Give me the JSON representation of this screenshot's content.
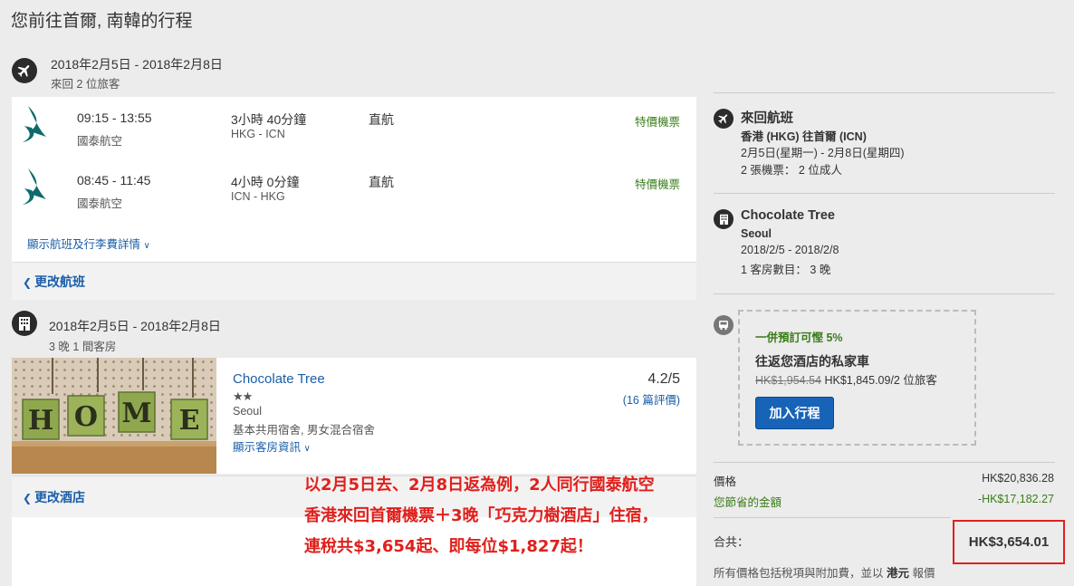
{
  "page": {
    "title": "您前往首爾, 南韓的行程"
  },
  "flight_section": {
    "date_range": "2018年2月5日 - 2018年2月8日",
    "sub": "來回 2 位旅客",
    "flights": [
      {
        "times": "09:15 - 13:55",
        "airline": "國泰航空",
        "duration": "3小時 40分鐘",
        "route": "HKG - ICN",
        "stops": "直航",
        "deal": "特價機票"
      },
      {
        "times": "08:45 - 11:45",
        "airline": "國泰航空",
        "duration": "4小時 0分鐘",
        "route": "ICN - HKG",
        "stops": "直航",
        "deal": "特價機票"
      }
    ],
    "details_link": "顯示航班及行李費詳情",
    "change_link": "更改航班"
  },
  "hotel_section": {
    "date_range": "2018年2月5日 - 2018年2月8日",
    "sub": "3 晚 1 間客房",
    "image_letters": [
      "H",
      "O",
      "M",
      "E"
    ],
    "name": "Chocolate Tree",
    "stars": "★★",
    "city": "Seoul",
    "type": "基本共用宿舍, 男女混合宿舍",
    "rooms_link": "顯示客房資訊",
    "rating": "4.2/5",
    "reviews": "(16 篇評價)",
    "change_link": "更改酒店"
  },
  "promo_overlay": {
    "lines": [
      "以2月5日去、2月8日返為例，2人同行國泰航空",
      "香港來回首爾機票＋3晚「巧克力樹酒店」住宿，",
      "連稅共$3,654起、即每位$1,827起！"
    ]
  },
  "sidebar": {
    "flight": {
      "title": "來回航班",
      "route": "香港 (HKG) 往首爾 (ICN)",
      "dates": "2月5日(星期一) - 2月8日(星期四)",
      "tickets": "2 張機票： 2 位成人"
    },
    "hotel": {
      "title": "Chocolate Tree",
      "city": "Seoul",
      "dates": "2018/2/5 - 2018/2/8",
      "rooms": "1 客房數目： 3 晚"
    },
    "transfer": {
      "savings": "一併預訂可慳 5%",
      "title": "往返您酒店的私家車",
      "old_price": "HK$1,954.54",
      "new_price": "HK$1,845.09/2 位旅客",
      "button": "加入行程"
    },
    "pricing": {
      "price_label": "價格",
      "price_value": "HK$20,836.28",
      "savings_label": "您節省的金額",
      "savings_value": "-HK$17,182.27",
      "total_label": "合共：",
      "total_value": "HK$3,654.01",
      "footnote_pre": "所有價格包括稅項與附加費，並以",
      "footnote_currency": "港元",
      "footnote_post": "報價"
    }
  },
  "colors": {
    "link": "#1a5ea8",
    "deal_green": "#3a7d1a",
    "highlight_red": "#e0201c",
    "button_blue": "#1763b8"
  }
}
